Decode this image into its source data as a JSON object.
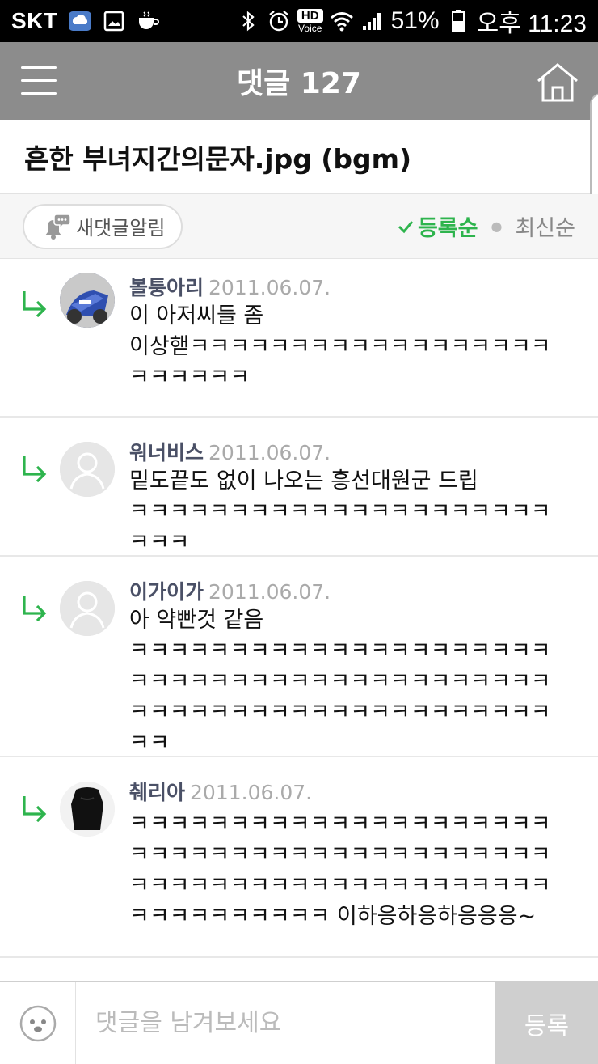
{
  "status_bar": {
    "carrier": "SKT",
    "battery": "51%",
    "time": "오후 11:23",
    "hd": "HD",
    "voice": "Voice"
  },
  "app_bar": {
    "title": "댓글 127"
  },
  "post": {
    "title": "흔한 부녀지간의문자.jpg (bgm)"
  },
  "sort_bar": {
    "notify_label": "새댓글알림",
    "sort_registered": "등록순",
    "sort_latest": "최신순"
  },
  "comments": [
    {
      "author": "볼퉁아리",
      "date": "2011.06.07.",
      "text": "이 아저씨들 좀\n이상핻ㅋㅋㅋㅋㅋㅋㅋㅋㅋㅋㅋㅋㅋㅋㅋㅋㅋㅋㅋㅋㅋㅋㅋㅋ"
    },
    {
      "author": "워너비스",
      "date": "2011.06.07.",
      "text": "밑도끝도 없이 나오는 흥선대원군 드립\nㅋㅋㅋㅋㅋㅋㅋㅋㅋㅋㅋㅋㅋㅋㅋㅋㅋㅋㅋㅋㅋㅋㅋㅋ"
    },
    {
      "author": "이가이가",
      "date": "2011.06.07.",
      "text": "아 약빤것 같음\nㅋㅋㅋㅋㅋㅋㅋㅋㅋㅋㅋㅋㅋㅋㅋㅋㅋㅋㅋㅋㅋㅋㅋㅋㅋㅋㅋㅋㅋㅋㅋㅋㅋㅋㅋㅋㅋㅋㅋㅋㅋㅋㅋㅋㅋㅋㅋㅋㅋㅋㅋㅋㅋㅋㅋㅋㅋㅋㅋㅋㅋㅋㅋㅋㅋ"
    },
    {
      "author": "췌리아",
      "date": "2011.06.07.",
      "text": "ㅋㅋㅋㅋㅋㅋㅋㅋㅋㅋㅋㅋㅋㅋㅋㅋㅋㅋㅋㅋㅋㅋㅋㅋㅋㅋㅋㅋㅋㅋㅋㅋㅋㅋㅋㅋㅋㅋㅋㅋㅋㅋㅋㅋㅋㅋㅋㅋㅋㅋㅋㅋㅋㅋㅋㅋㅋㅋㅋㅋㅋㅋㅋㅋㅋㅋㅋㅋㅋㅋㅋㅋㅋ 이하응하응하응응응~"
    }
  ],
  "input_bar": {
    "placeholder": "댓글을 남겨보세요",
    "submit_label": "등록"
  },
  "colors": {
    "accent_green": "#2eb44d",
    "app_bar_gray": "#8c8c8c",
    "submit_gray": "#cfcfcf"
  }
}
